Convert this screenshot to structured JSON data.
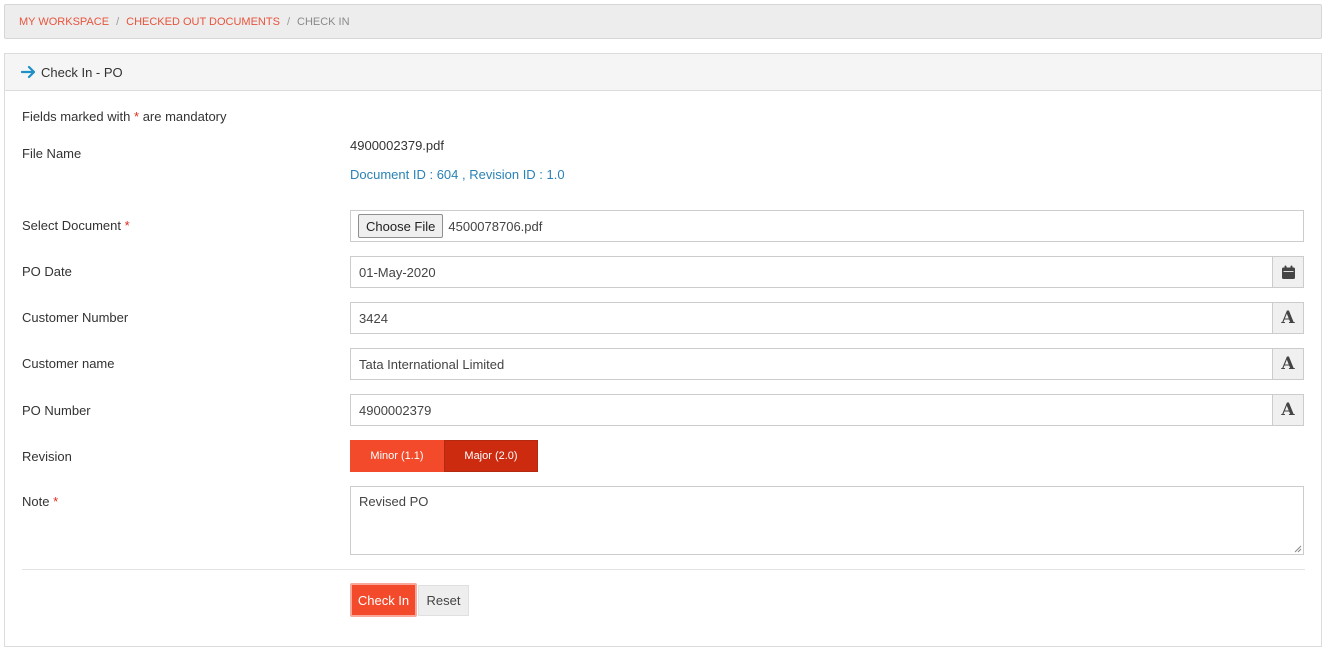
{
  "breadcrumb": {
    "items": [
      "My Workspace",
      "Checked Out Documents"
    ],
    "current": "Check In",
    "separator": "/"
  },
  "panel": {
    "title": "Check In - PO"
  },
  "form": {
    "mandatory_prefix": "Fields marked with",
    "mandatory_star": "*",
    "mandatory_suffix": "are mandatory",
    "file_name_label": "File Name",
    "file_name": "4900002379.pdf",
    "doc_info": "Document ID : 604 , Revision ID : 1.0",
    "select_document_label": "Select Document",
    "choose_file_label": "Choose File",
    "chosen_file": "4500078706.pdf",
    "po_date_label": "PO Date",
    "po_date": "01-May-2020",
    "customer_number_label": "Customer Number",
    "customer_number": "3424",
    "customer_name_label": "Customer name",
    "customer_name": "Tata International Limited",
    "po_number_label": "PO Number",
    "po_number": "4900002379",
    "text_addon": "A",
    "revision_label": "Revision",
    "revision_minor": "Minor (1.1)",
    "revision_major": "Major (2.0)",
    "note_label": "Note",
    "note_value": "Revised PO"
  },
  "actions": {
    "check_in": "Check In",
    "reset": "Reset"
  },
  "colors": {
    "accent": "#f24a2a",
    "accent_dark": "#cc2b10",
    "link": "#2a82b5",
    "breadcrumb_link": "#e8543c"
  }
}
